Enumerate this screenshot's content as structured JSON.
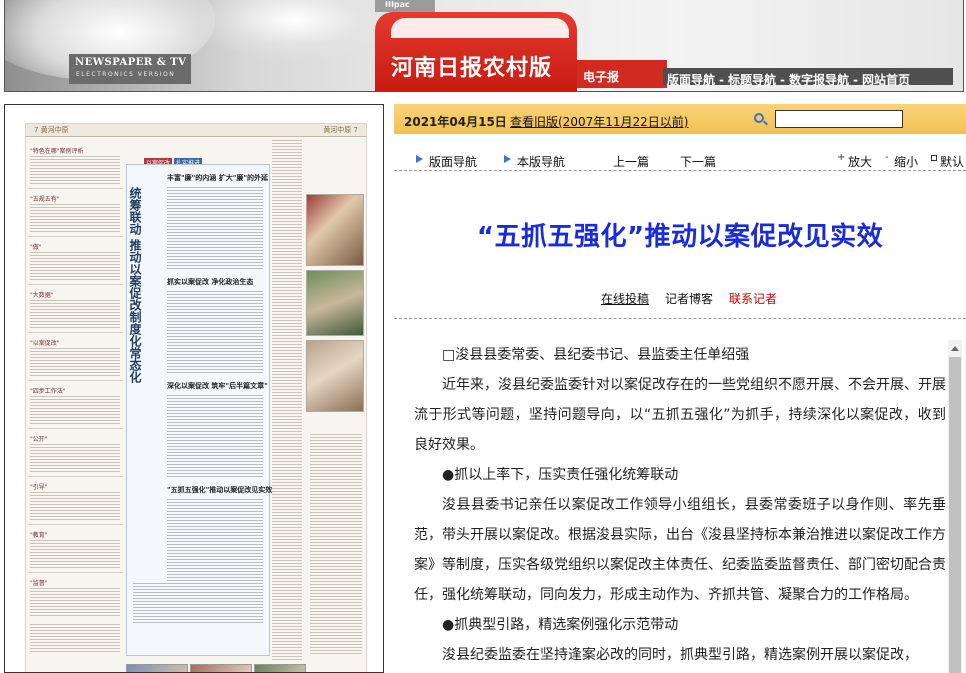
{
  "header": {
    "brand_en": "NEWSPAPER & TV",
    "brand_sub": "ELECTRONICS VERSION",
    "logo_mark": "IIIpac",
    "title": "河南日报农村版",
    "ebook": "电子报",
    "nav": [
      "版面导航",
      "标题导航",
      "数字报导航",
      "网站首页"
    ],
    "nav_sep": "-"
  },
  "newspaper": {
    "topbar_left": "7  黄河中原",
    "topbar_right": "黄河中原  7",
    "vertical_title_1": "统筹联动  推动以案促改制度化常态化",
    "vertical_title_2": "",
    "banner_1": "丰富\"廉\"的内涵  扩大\"廉\"的外延",
    "banner_2": "抓实以案促改  净化政治生态",
    "banner_3": "深化以案促改  筑牢\"后半篇文章\"",
    "banner_4": "\"五抓五强化\"推动以案促改见实效",
    "left_heads": [
      "\"特色在哪\"案例评析",
      "\"五规五有\"",
      "\"做\"",
      "\"大数据\"",
      "\"以案促改\"",
      "\"四步工作法\"",
      "\"公开\"",
      "\"引导\"",
      "\"教育\"",
      "\"监督\""
    ],
    "tag_1": "以案促改",
    "tag_2": "扎实推进"
  },
  "date_bar": {
    "date": "2021年04月15日",
    "old_link": "查看旧版(2007年11月22日以前)",
    "search_placeholder": ""
  },
  "toolbar": {
    "layout_nav": "版面导航",
    "page_nav": "本版导航",
    "prev": "上一篇",
    "next": "下一篇",
    "zoom_in": "放大",
    "zoom_out": "缩小",
    "default": "默认"
  },
  "article": {
    "title": "“五抓五强化”推动以案促改见实效",
    "link_submit": "在线投稿",
    "link_blog": "记者博客",
    "link_contact": "联系记者",
    "paragraphs": [
      "□浚县县委常委、县纪委书记、县监委主任单绍强",
      "近年来，浚县纪委监委针对以案促改存在的一些党组织不愿开展、不会开展、开展流于形式等问题，坚持问题导向，以“五抓五强化”为抓手，持续深化以案促改，收到良好效果。",
      "●抓以上率下，压实责任强化统筹联动",
      "浚县县委书记亲任以案促改工作领导小组组长，县委常委班子以身作则、率先垂范，带头开展以案促改。根据浚县实际，出台《浚县坚持标本兼治推进以案促改工作方案》等制度，压实各级党组织以案促改主体责任、纪委监委监督责任、部门密切配合责任，强化统筹联动，同向发力，形成主动作为、齐抓共管、凝聚合力的工作格局。",
      "●抓典型引路，精选案例强化示范带动",
      "浚县纪委监委在坚持逢案必改的同时，抓典型引路，精选案例开展以案促改，"
    ]
  },
  "colors": {
    "title_blue": "#1a2bd8",
    "date_bar": "#f3c050",
    "brand_red": "#c81a12",
    "contact_red": "#cc0000"
  }
}
